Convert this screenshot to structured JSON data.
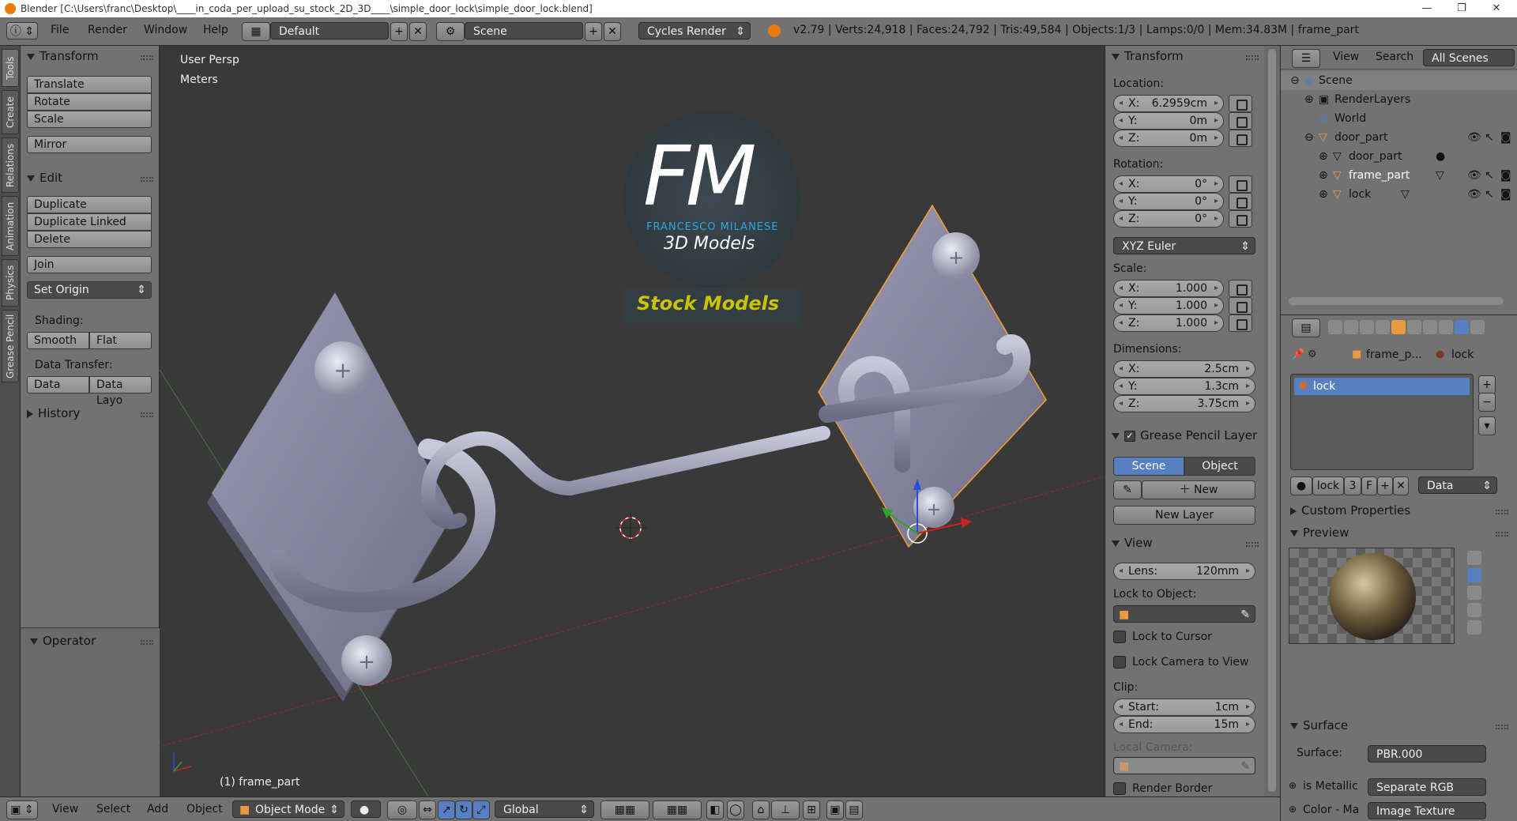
{
  "titlebar": {
    "title": "Blender [C:\\Users\\franc\\Desktop\\____in_coda_per_upload_su_stock_2D_3D____\\simple_door_lock\\simple_door_lock.blend]"
  },
  "menu": {
    "file": "File",
    "render": "Render",
    "window": "Window",
    "help": "Help"
  },
  "screen_layout": "Default",
  "scene_name": "Scene",
  "render_engine": "Cycles Render",
  "stats": "v2.79 | Verts:24,918 | Faces:24,792 | Tris:49,584 | Objects:1/3 | Lamps:0/0 | Mem:34.83M | frame_part",
  "left_tabs": [
    "Tools",
    "Create",
    "Relations",
    "Animation",
    "Physics",
    "Grease Pencil"
  ],
  "toolshelf": {
    "transform_header": "Transform",
    "translate": "Translate",
    "rotate": "Rotate",
    "scale": "Scale",
    "mirror": "Mirror",
    "edit_header": "Edit",
    "duplicate": "Duplicate",
    "duplicate_linked": "Duplicate Linked",
    "delete": "Delete",
    "join": "Join",
    "set_origin": "Set Origin",
    "shading_label": "Shading:",
    "smooth": "Smooth",
    "flat": "Flat",
    "data_transfer_label": "Data Transfer:",
    "data": "Data",
    "data_layout": "Data Layo",
    "history_header": "History",
    "operator_header": "Operator"
  },
  "viewport": {
    "view_name": "User Persp",
    "units": "Meters",
    "object_label": "(1) frame_part",
    "logo_letters": "FM",
    "logo_brand": "FRANCESCO MILANESE",
    "logo_subtitle": "3D Models",
    "stock_label": "Stock Models"
  },
  "npanel": {
    "transform_header": "Transform",
    "location_label": "Location:",
    "loc": [
      {
        "k": "X:",
        "v": "6.2959cm"
      },
      {
        "k": "Y:",
        "v": "0m"
      },
      {
        "k": "Z:",
        "v": "0m"
      }
    ],
    "rotation_label": "Rotation:",
    "rot": [
      {
        "k": "X:",
        "v": "0°"
      },
      {
        "k": "Y:",
        "v": "0°"
      },
      {
        "k": "Z:",
        "v": "0°"
      }
    ],
    "rotation_mode": "XYZ Euler",
    "scale_label": "Scale:",
    "scl": [
      {
        "k": "X:",
        "v": "1.000"
      },
      {
        "k": "Y:",
        "v": "1.000"
      },
      {
        "k": "Z:",
        "v": "1.000"
      }
    ],
    "dimensions_label": "Dimensions:",
    "dim": [
      {
        "k": "X:",
        "v": "2.5cm"
      },
      {
        "k": "Y:",
        "v": "1.3cm"
      },
      {
        "k": "Z:",
        "v": "3.75cm"
      }
    ],
    "gp_header": "Grease Pencil Layer",
    "scene_tab": "Scene",
    "object_tab": "Object",
    "new_btn": "New",
    "new_layer_btn": "New Layer",
    "view_header": "View",
    "lens_k": "Lens:",
    "lens_v": "120mm",
    "lock_to_object": "Lock to Object:",
    "lock_to_cursor": "Lock to Cursor",
    "lock_camera": "Lock Camera to View",
    "clip_label": "Clip:",
    "clip_start_k": "Start:",
    "clip_start_v": "1cm",
    "clip_end_k": "End:",
    "clip_end_v": "15m",
    "local_camera": "Local Camera:",
    "render_border": "Render Border"
  },
  "outliner": {
    "view": "View",
    "search": "Search",
    "all_scenes": "All Scenes",
    "rows": [
      "Scene",
      "RenderLayers",
      "World",
      "door_part",
      "door_part",
      "frame_part",
      "lock"
    ]
  },
  "properties": {
    "crumb_object": "frame_p...",
    "crumb_material": "lock",
    "slot_name": "lock",
    "mat_name": "lock",
    "mat_users": "3",
    "mat_fake": "F",
    "link_mode": "Data",
    "custom_props": "Custom Properties",
    "preview": "Preview",
    "surface_header": "Surface",
    "surface_k": "Surface:",
    "surface_v": "PBR.000",
    "metallic_k": "is Metallic",
    "metallic_v": "Separate RGB",
    "color_k": "Color - Ma",
    "color_v": "Image Texture"
  },
  "bottombar": {
    "view": "View",
    "select": "Select",
    "add": "Add",
    "object": "Object",
    "mode": "Object Mode",
    "orientation": "Global"
  },
  "colors": {
    "accent_blue": "#5680c2",
    "logo_cyan": "#29a9e1",
    "stock_yellow": "#c9c400",
    "selection_orange": "#f0a030"
  }
}
